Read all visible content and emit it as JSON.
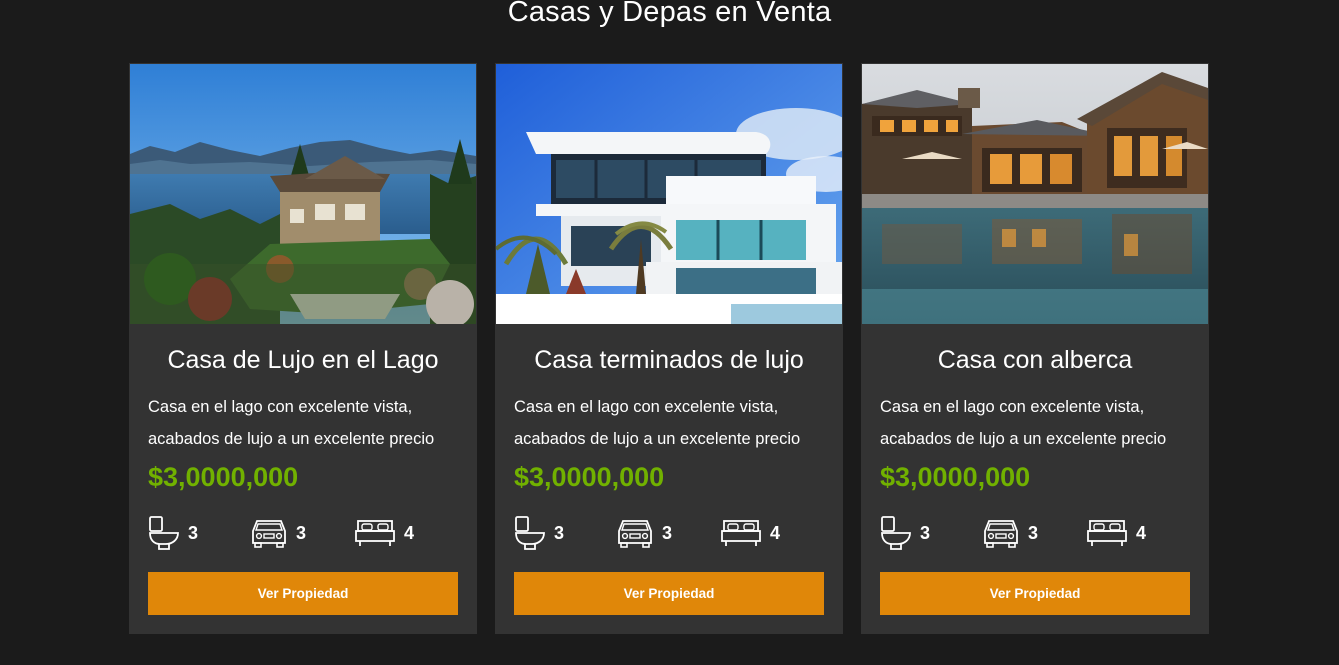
{
  "page": {
    "title": "Casas y Depas en Venta"
  },
  "colors": {
    "background": "#1b1b1b",
    "card": "#333333",
    "price": "#71b100",
    "button": "#e08709"
  },
  "listings": [
    {
      "title": "Casa de Lujo en el Lago",
      "description": "Casa en el lago con excelente vista, acabados de lujo a un excelente precio",
      "price": "$3,0000,000",
      "bathrooms": "3",
      "parking": "3",
      "bedrooms": "4",
      "button_label": "Ver Propiedad",
      "image_icon": "lake-house-photo"
    },
    {
      "title": "Casa terminados de lujo",
      "description": "Casa en el lago con excelente vista, acabados de lujo a un excelente precio",
      "price": "$3,0000,000",
      "bathrooms": "3",
      "parking": "3",
      "bedrooms": "4",
      "button_label": "Ver Propiedad",
      "image_icon": "modern-house-photo"
    },
    {
      "title": "Casa con alberca",
      "description": "Casa en el lago con excelente vista, acabados de lujo a un excelente precio",
      "price": "$3,0000,000",
      "bathrooms": "3",
      "parking": "3",
      "bedrooms": "4",
      "button_label": "Ver Propiedad",
      "image_icon": "pool-house-photo"
    }
  ],
  "feature_icons": [
    "toilet-icon",
    "car-icon",
    "bed-icon"
  ]
}
